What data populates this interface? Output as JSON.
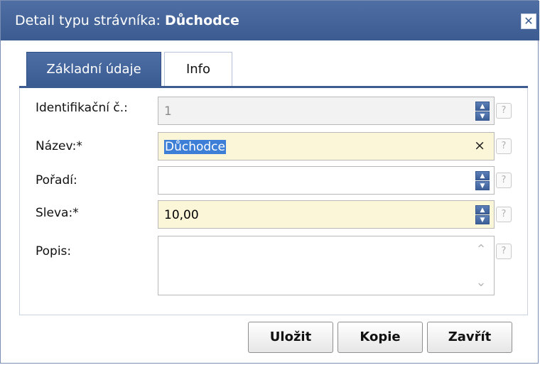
{
  "window": {
    "title_prefix": "Detail typu strávníka:",
    "title_name": "Důchodce",
    "close_symbol": "✕"
  },
  "tabs": [
    {
      "label": "Základní údaje",
      "active": true
    },
    {
      "label": "Info",
      "active": false
    }
  ],
  "form": {
    "identifikacni": {
      "label": "Identifikační č.:",
      "value": "1"
    },
    "nazev": {
      "label": "Název:*",
      "value": "Důchodce"
    },
    "poradi": {
      "label": "Pořadí:",
      "value": ""
    },
    "sleva": {
      "label": "Sleva:*",
      "value": "10,00"
    },
    "popis": {
      "label": "Popis:",
      "value": ""
    }
  },
  "buttons": {
    "save": "Uložit",
    "copy": "Kopie",
    "close": "Zavřít"
  },
  "icons": {
    "help": "?",
    "clear": "×",
    "spin_up": "▲",
    "spin_down": "▼",
    "scroll_up": "⌃",
    "scroll_down": "⌄"
  },
  "colors": {
    "titlebar": "#3b5b91",
    "required_field": "#fbf6d8",
    "selection": "#3d7ed6"
  }
}
